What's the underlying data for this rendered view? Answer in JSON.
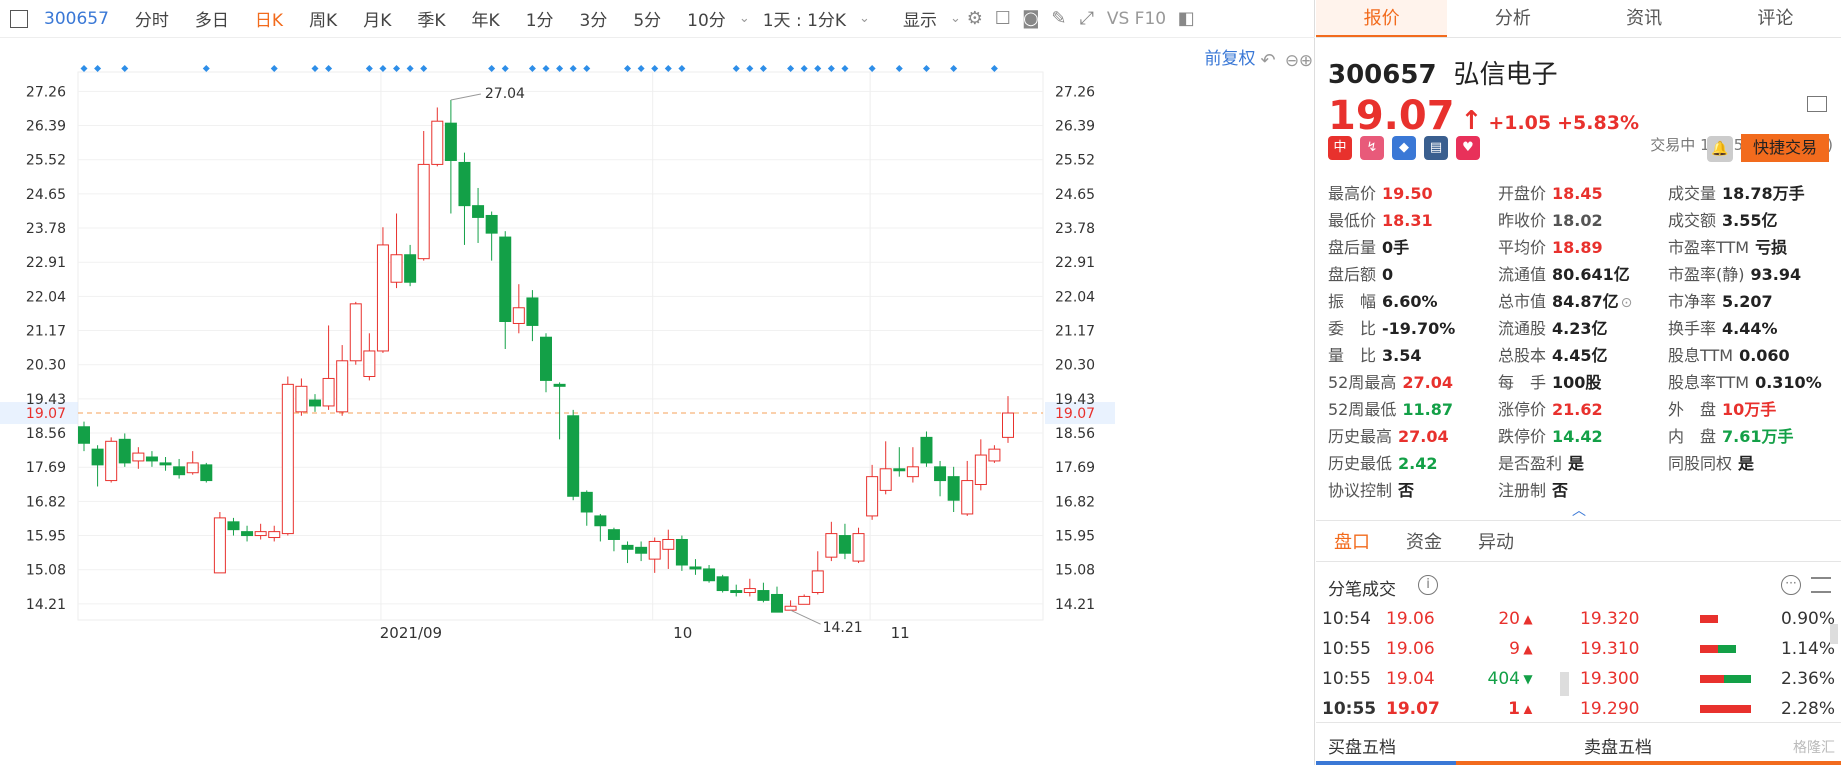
{
  "toolbar": {
    "code": "300657",
    "items": [
      "分时",
      "多日",
      "日K",
      "周K",
      "月K",
      "季K",
      "年K",
      "1分",
      "3分",
      "5分",
      "10分"
    ],
    "active_index": 2,
    "period": "1天 : 1分K",
    "display": "显示",
    "vs_f10": "VS F10"
  },
  "chart_header": {
    "adjust": "前复权"
  },
  "chart_data": {
    "type": "candlestick",
    "price_ticks": [
      "27.26",
      "26.39",
      "25.52",
      "24.65",
      "23.78",
      "22.91",
      "22.04",
      "21.17",
      "20.30",
      "19.43",
      "18.56",
      "17.69",
      "16.82",
      "15.95",
      "15.08",
      "14.21"
    ],
    "ylim": [
      13.8,
      27.6
    ],
    "x_labels": [
      {
        "label": "2021/09",
        "index": 22
      },
      {
        "label": "10",
        "index": 42
      },
      {
        "label": "11",
        "index": 58
      }
    ],
    "current_price": "19.07",
    "max_label": "27.04",
    "min_label": "14.21",
    "max_index": 27,
    "min_index": 52,
    "candles": [
      [
        18.72,
        18.3,
        18.85,
        18.1
      ],
      [
        18.15,
        17.75,
        18.25,
        17.2
      ],
      [
        17.35,
        18.35,
        18.45,
        17.3
      ],
      [
        18.4,
        17.8,
        18.55,
        17.7
      ],
      [
        17.85,
        18.05,
        18.2,
        17.65
      ],
      [
        17.95,
        17.85,
        18.1,
        17.7
      ],
      [
        17.8,
        17.75,
        17.95,
        17.6
      ],
      [
        17.7,
        17.5,
        17.9,
        17.4
      ],
      [
        17.55,
        17.8,
        18.1,
        17.5
      ],
      [
        17.75,
        17.35,
        17.8,
        17.3
      ],
      [
        15.0,
        16.4,
        16.55,
        15.0
      ],
      [
        16.3,
        16.1,
        16.4,
        15.95
      ],
      [
        16.05,
        15.95,
        16.2,
        15.8
      ],
      [
        15.95,
        16.05,
        16.25,
        15.85
      ],
      [
        15.9,
        16.05,
        16.2,
        15.8
      ],
      [
        16.0,
        19.8,
        20.0,
        15.95
      ],
      [
        19.1,
        19.75,
        19.95,
        19.0
      ],
      [
        19.4,
        19.25,
        19.55,
        19.1
      ],
      [
        19.25,
        19.95,
        21.3,
        19.15
      ],
      [
        19.1,
        20.4,
        20.8,
        19.0
      ],
      [
        20.4,
        21.85,
        21.9,
        20.3
      ],
      [
        20.0,
        20.65,
        21.1,
        19.9
      ],
      [
        20.65,
        23.35,
        23.8,
        20.6
      ],
      [
        22.4,
        23.1,
        24.15,
        22.25
      ],
      [
        23.1,
        22.4,
        23.35,
        22.3
      ],
      [
        23.0,
        25.4,
        26.25,
        22.95
      ],
      [
        25.4,
        26.5,
        26.85,
        25.35
      ],
      [
        26.45,
        25.5,
        27.04,
        24.15
      ],
      [
        25.45,
        24.35,
        25.7,
        23.35
      ],
      [
        24.35,
        24.05,
        24.8,
        23.4
      ],
      [
        24.1,
        23.65,
        24.2,
        22.95
      ],
      [
        23.55,
        21.4,
        23.7,
        20.7
      ],
      [
        21.35,
        21.75,
        22.35,
        21.1
      ],
      [
        22.0,
        21.3,
        22.2,
        20.9
      ],
      [
        21.0,
        19.9,
        21.1,
        19.6
      ],
      [
        19.8,
        19.75,
        19.85,
        18.4
      ],
      [
        19.0,
        16.95,
        19.15,
        16.85
      ],
      [
        17.05,
        16.55,
        17.1,
        16.2
      ],
      [
        16.45,
        16.2,
        16.5,
        15.8
      ],
      [
        16.1,
        15.85,
        16.15,
        15.55
      ],
      [
        15.7,
        15.6,
        15.8,
        15.25
      ],
      [
        15.65,
        15.5,
        15.8,
        15.3
      ],
      [
        15.35,
        15.8,
        15.9,
        15.0
      ],
      [
        15.6,
        15.85,
        16.1,
        15.1
      ],
      [
        15.85,
        15.2,
        15.95,
        15.05
      ],
      [
        15.15,
        15.1,
        15.35,
        14.95
      ],
      [
        15.1,
        14.8,
        15.2,
        14.75
      ],
      [
        14.9,
        14.55,
        14.95,
        14.5
      ],
      [
        14.55,
        14.5,
        14.7,
        14.4
      ],
      [
        14.5,
        14.6,
        14.85,
        14.4
      ],
      [
        14.55,
        14.3,
        14.75,
        14.25
      ],
      [
        14.45,
        14.0,
        14.65,
        14.0
      ],
      [
        14.05,
        14.15,
        14.3,
        14.05
      ],
      [
        14.2,
        14.4,
        14.45,
        14.21
      ],
      [
        14.5,
        15.05,
        15.55,
        14.45
      ],
      [
        15.4,
        16.0,
        16.3,
        15.3
      ],
      [
        15.95,
        15.5,
        16.25,
        15.35
      ],
      [
        15.3,
        16.0,
        16.15,
        15.25
      ],
      [
        16.45,
        17.45,
        17.75,
        16.35
      ],
      [
        17.1,
        17.65,
        18.35,
        17.0
      ],
      [
        17.65,
        17.6,
        18.2,
        17.45
      ],
      [
        17.45,
        17.7,
        18.2,
        17.3
      ],
      [
        18.45,
        17.8,
        18.6,
        17.7
      ],
      [
        17.7,
        17.35,
        17.85,
        16.95
      ],
      [
        17.45,
        16.85,
        17.7,
        16.55
      ],
      [
        16.5,
        17.35,
        17.85,
        16.45
      ],
      [
        17.25,
        18.0,
        18.4,
        17.1
      ],
      [
        17.85,
        18.15,
        18.25,
        17.8
      ],
      [
        18.45,
        19.07,
        19.5,
        18.31
      ]
    ]
  },
  "tabs": [
    "报价",
    "分析",
    "资讯",
    "评论"
  ],
  "stock": {
    "code": "300657",
    "name": "弘信电子",
    "price": "19.07",
    "change": "+1.05",
    "pct": "+5.83%",
    "status": "交易中 11/15 10:55(北京)"
  },
  "badges": [
    "中",
    "↯",
    "◆",
    "▤",
    "♥"
  ],
  "fast_trade": "快捷交易",
  "quote_rows": [
    [
      {
        "l": "最高价",
        "v": "19.50",
        "c": "up"
      },
      {
        "l": "开盘价",
        "v": "18.45",
        "c": "up"
      },
      {
        "l": "成交量",
        "v": "18.78万手",
        "c": ""
      }
    ],
    [
      {
        "l": "最低价",
        "v": "18.31",
        "c": "up"
      },
      {
        "l": "昨收价",
        "v": "18.02",
        "c": "gray"
      },
      {
        "l": "成交额",
        "v": "3.55亿",
        "c": ""
      }
    ],
    [
      {
        "l": "盘后量",
        "v": "0手",
        "c": ""
      },
      {
        "l": "平均价",
        "v": "18.89",
        "c": "up"
      },
      {
        "l": "市盈率TTM",
        "v": "亏损",
        "c": ""
      }
    ],
    [
      {
        "l": "盘后额",
        "v": "0",
        "c": ""
      },
      {
        "l": "流通值",
        "v": "80.641亿",
        "c": ""
      },
      {
        "l": "市盈率(静)",
        "v": "93.94",
        "c": ""
      }
    ],
    [
      {
        "l": "振　幅",
        "v": "6.60%",
        "c": ""
      },
      {
        "l": "总市值",
        "v": "84.87亿",
        "c": ""
      },
      {
        "l": "市净率",
        "v": "5.207",
        "c": ""
      }
    ],
    [
      {
        "l": "委　比",
        "v": "-19.70%",
        "c": ""
      },
      {
        "l": "流通股",
        "v": "4.23亿",
        "c": ""
      },
      {
        "l": "换手率",
        "v": "4.44%",
        "c": ""
      }
    ],
    [
      {
        "l": "量　比",
        "v": "3.54",
        "c": ""
      },
      {
        "l": "总股本",
        "v": "4.45亿",
        "c": ""
      },
      {
        "l": "股息TTM",
        "v": "0.060",
        "c": ""
      }
    ],
    [
      {
        "l": "52周最高",
        "v": "27.04",
        "c": "up"
      },
      {
        "l": "每　手",
        "v": "100股",
        "c": ""
      },
      {
        "l": "股息率TTM",
        "v": "0.310%",
        "c": ""
      }
    ],
    [
      {
        "l": "52周最低",
        "v": "11.87",
        "c": "down"
      },
      {
        "l": "涨停价",
        "v": "21.62",
        "c": "up"
      },
      {
        "l": "外　盘",
        "v": "10万手",
        "c": "up"
      }
    ],
    [
      {
        "l": "历史最高",
        "v": "27.04",
        "c": "up"
      },
      {
        "l": "跌停价",
        "v": "14.42",
        "c": "down"
      },
      {
        "l": "内　盘",
        "v": "7.61万手",
        "c": "down"
      }
    ],
    [
      {
        "l": "历史最低",
        "v": "2.42",
        "c": "down"
      },
      {
        "l": "是否盈利",
        "v": "是",
        "c": ""
      },
      {
        "l": "同股同权",
        "v": "是",
        "c": ""
      }
    ],
    [
      {
        "l": "协议控制",
        "v": "否",
        "c": ""
      },
      {
        "l": "注册制",
        "v": "否",
        "c": ""
      },
      {
        "l": "",
        "v": "",
        "c": ""
      }
    ]
  ],
  "sub_tabs": [
    "盘口",
    "资金",
    "异动"
  ],
  "trade_title": "分笔成交",
  "ticks": [
    {
      "t": "10:54",
      "p": "19.06",
      "v": "20",
      "dir": "up"
    },
    {
      "t": "10:55",
      "p": "19.06",
      "v": "9",
      "dir": "up"
    },
    {
      "t": "10:55",
      "p": "19.04",
      "v": "404",
      "dir": "down"
    },
    {
      "t": "10:55",
      "p": "19.07",
      "v": "1",
      "dir": "up"
    }
  ],
  "depth": [
    {
      "p": "19.320",
      "pct": "0.90%",
      "red": 0.3,
      "green": 0.0
    },
    {
      "p": "19.310",
      "pct": "1.14%",
      "red": 0.3,
      "green": 0.3
    },
    {
      "p": "19.300",
      "pct": "2.36%",
      "red": 0.4,
      "green": 0.45
    },
    {
      "p": "19.290",
      "pct": "2.28%",
      "red": 0.85,
      "green": 0.0
    }
  ],
  "bottom_tabs": [
    "买盘五档",
    "卖盘五档"
  ],
  "watermark": "格隆汇",
  "colors": {
    "up": "#e8312d",
    "down": "#13a047",
    "accent": "#f26b1d",
    "link": "#3a78d6"
  }
}
